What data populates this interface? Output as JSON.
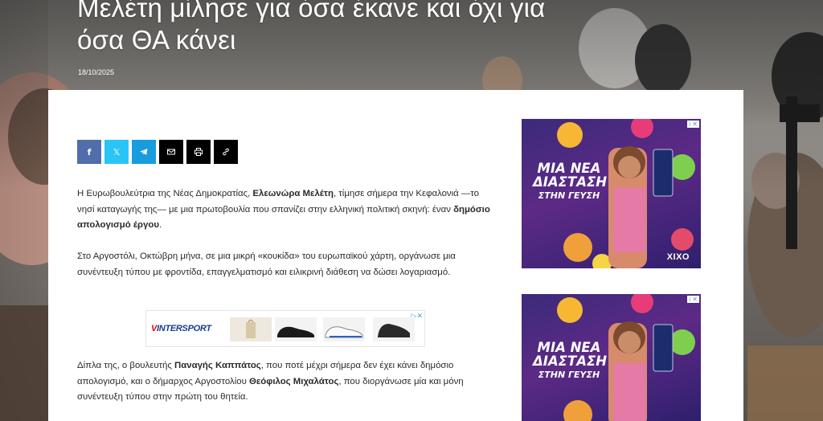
{
  "article": {
    "title": "Μελέτη μίλησε για όσα έκανε και όχι για όσα ΘΑ κάνει",
    "date": "18/10/2025",
    "p1_a": "Η Ευρωβουλεύτρια της Νέας Δημοκρατίας, ",
    "p1_b": "Ελεωνώρα Μελέτη",
    "p1_c": ", τίμησε σήμερα την Κεφαλονιά —το νησί καταγωγής της— με μια πρωτοβουλία που σπανίζει στην ελληνική πολιτική σκηνή: έναν ",
    "p1_d": "δημόσιο απολογισμό έργου",
    "p1_e": ".",
    "p2": "Στο Αργοστόλι, Οκτώβρη μήνα, σε μια μικρή «κουκίδα» του ευρωπαϊκού χάρτη, οργάνωσε μια συνέντευξη τύπου με φροντίδα, επαγγελματισμό και ειλικρινή διάθεση να δώσει λογαριασμό.",
    "p3_a": "Δίπλα της, ο βουλευτής ",
    "p3_b": "Παναγής Καππάτος",
    "p3_c": ", που ποτέ μέχρι σήμερα δεν έχει κάνει δημόσιο απολογισμό, και ο δήμαρχος Αργοστολίου ",
    "p3_d": "Θεόφιλος Μιχαλάτος",
    "p3_e": ", που διοργάνωσε μία και μόνη συνέντευξη τύπου στην πρώτη του θητεία."
  },
  "share": [
    {
      "name": "facebook",
      "icon": "f",
      "color": "#516eab"
    },
    {
      "name": "twitter",
      "icon": "𝕏",
      "color": "#29c5f6"
    },
    {
      "name": "telegram",
      "icon": "telegram-icon",
      "color": "#179cde"
    },
    {
      "name": "email",
      "icon": "envelope-icon",
      "color": "#000000"
    },
    {
      "name": "print",
      "icon": "printer-icon",
      "color": "#000000"
    },
    {
      "name": "copy-link",
      "icon": "link-icon",
      "color": "#000000"
    }
  ],
  "inline_ad": {
    "brand_a": "V",
    "brand_b": "INTERSPORT",
    "ad_choices": "▷✕"
  },
  "side_ad": {
    "line1": "ΜΙΑ ΝΕΑ",
    "line2": "ΔΙΑΣΤΑΣΗ",
    "line3": "ΣΤΗΝ ΓΕΥΣΗ",
    "brand": "XIXO",
    "can_label": "XIXO",
    "tag": "i ✕"
  },
  "colors": {
    "panel": "#ffffff",
    "text": "#2a2a2a",
    "ad_bg": "#4a2a82"
  }
}
